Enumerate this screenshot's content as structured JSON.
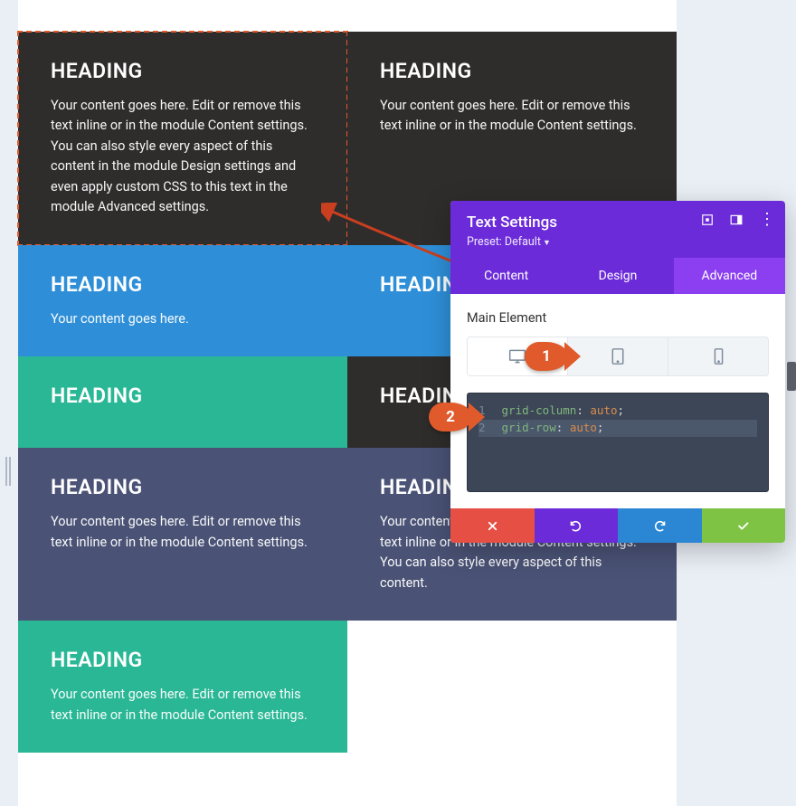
{
  "grid": {
    "cells": [
      {
        "heading": "HEADING",
        "body": "Your content goes here. Edit or remove this text inline or in the module Content settings. You can also style every aspect of this content in the module Design settings and even apply custom CSS to this text in the module Advanced settings."
      },
      {
        "heading": "HEADING",
        "body": "Your content goes here. Edit or remove this text inline or in the module Content settings."
      },
      {
        "heading": "HEADING",
        "body": "Your content goes here."
      },
      {
        "heading": "HEADING",
        "body": ""
      },
      {
        "heading": "HEADING",
        "body": ""
      },
      {
        "heading": "HEADING",
        "body": ""
      },
      {
        "heading": "HEADING",
        "body": "Your content goes here. Edit or remove this text inline or in the module Content settings."
      },
      {
        "heading": "HEADING",
        "body": "Your content goes here. Edit or remove this text inline or in the module Content settings. You can also style every aspect of this content."
      },
      {
        "heading": "HEADING",
        "body": "Your content goes here. Edit or remove this text inline or in the module Content settings."
      }
    ]
  },
  "panel": {
    "title": "Text Settings",
    "preset_label": "Preset: Default",
    "tabs": {
      "content": "Content",
      "design": "Design",
      "advanced": "Advanced"
    },
    "section_label": "Main Element",
    "code": {
      "l1_num": "1",
      "l1_prop": "grid-column",
      "l1_val": "auto",
      "l2_num": "2",
      "l2_prop": "grid-row",
      "l2_val": "auto"
    }
  },
  "callouts": {
    "one": "1",
    "two": "2"
  }
}
